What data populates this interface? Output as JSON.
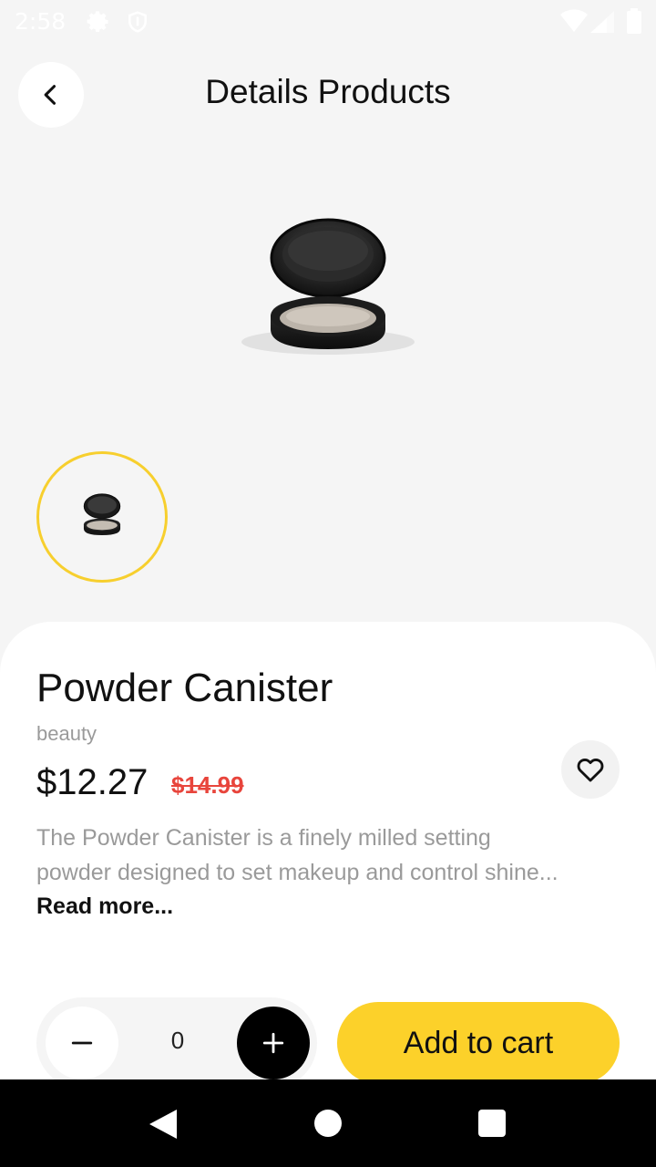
{
  "status_bar": {
    "time": "2:58"
  },
  "header": {
    "title": "Details Products"
  },
  "product": {
    "name": "Powder Canister",
    "category": "beauty",
    "price": "$12.27",
    "old_price": "$14.99",
    "description_line1": "The Powder Canister is a finely milled setting",
    "description_line2": "powder designed to set makeup and control shine...",
    "read_more": "Read more..."
  },
  "cart": {
    "quantity": "0",
    "add_label": "Add to cart"
  },
  "colors": {
    "accent": "#fcd12a",
    "sale": "#e8453c",
    "thumb_border": "#f7cf2e"
  },
  "icons": [
    "gear-icon",
    "shield-icon",
    "wifi-icon",
    "signal-icon",
    "battery-icon",
    "back-chevron-icon",
    "heart-icon",
    "minus-icon",
    "plus-icon"
  ]
}
